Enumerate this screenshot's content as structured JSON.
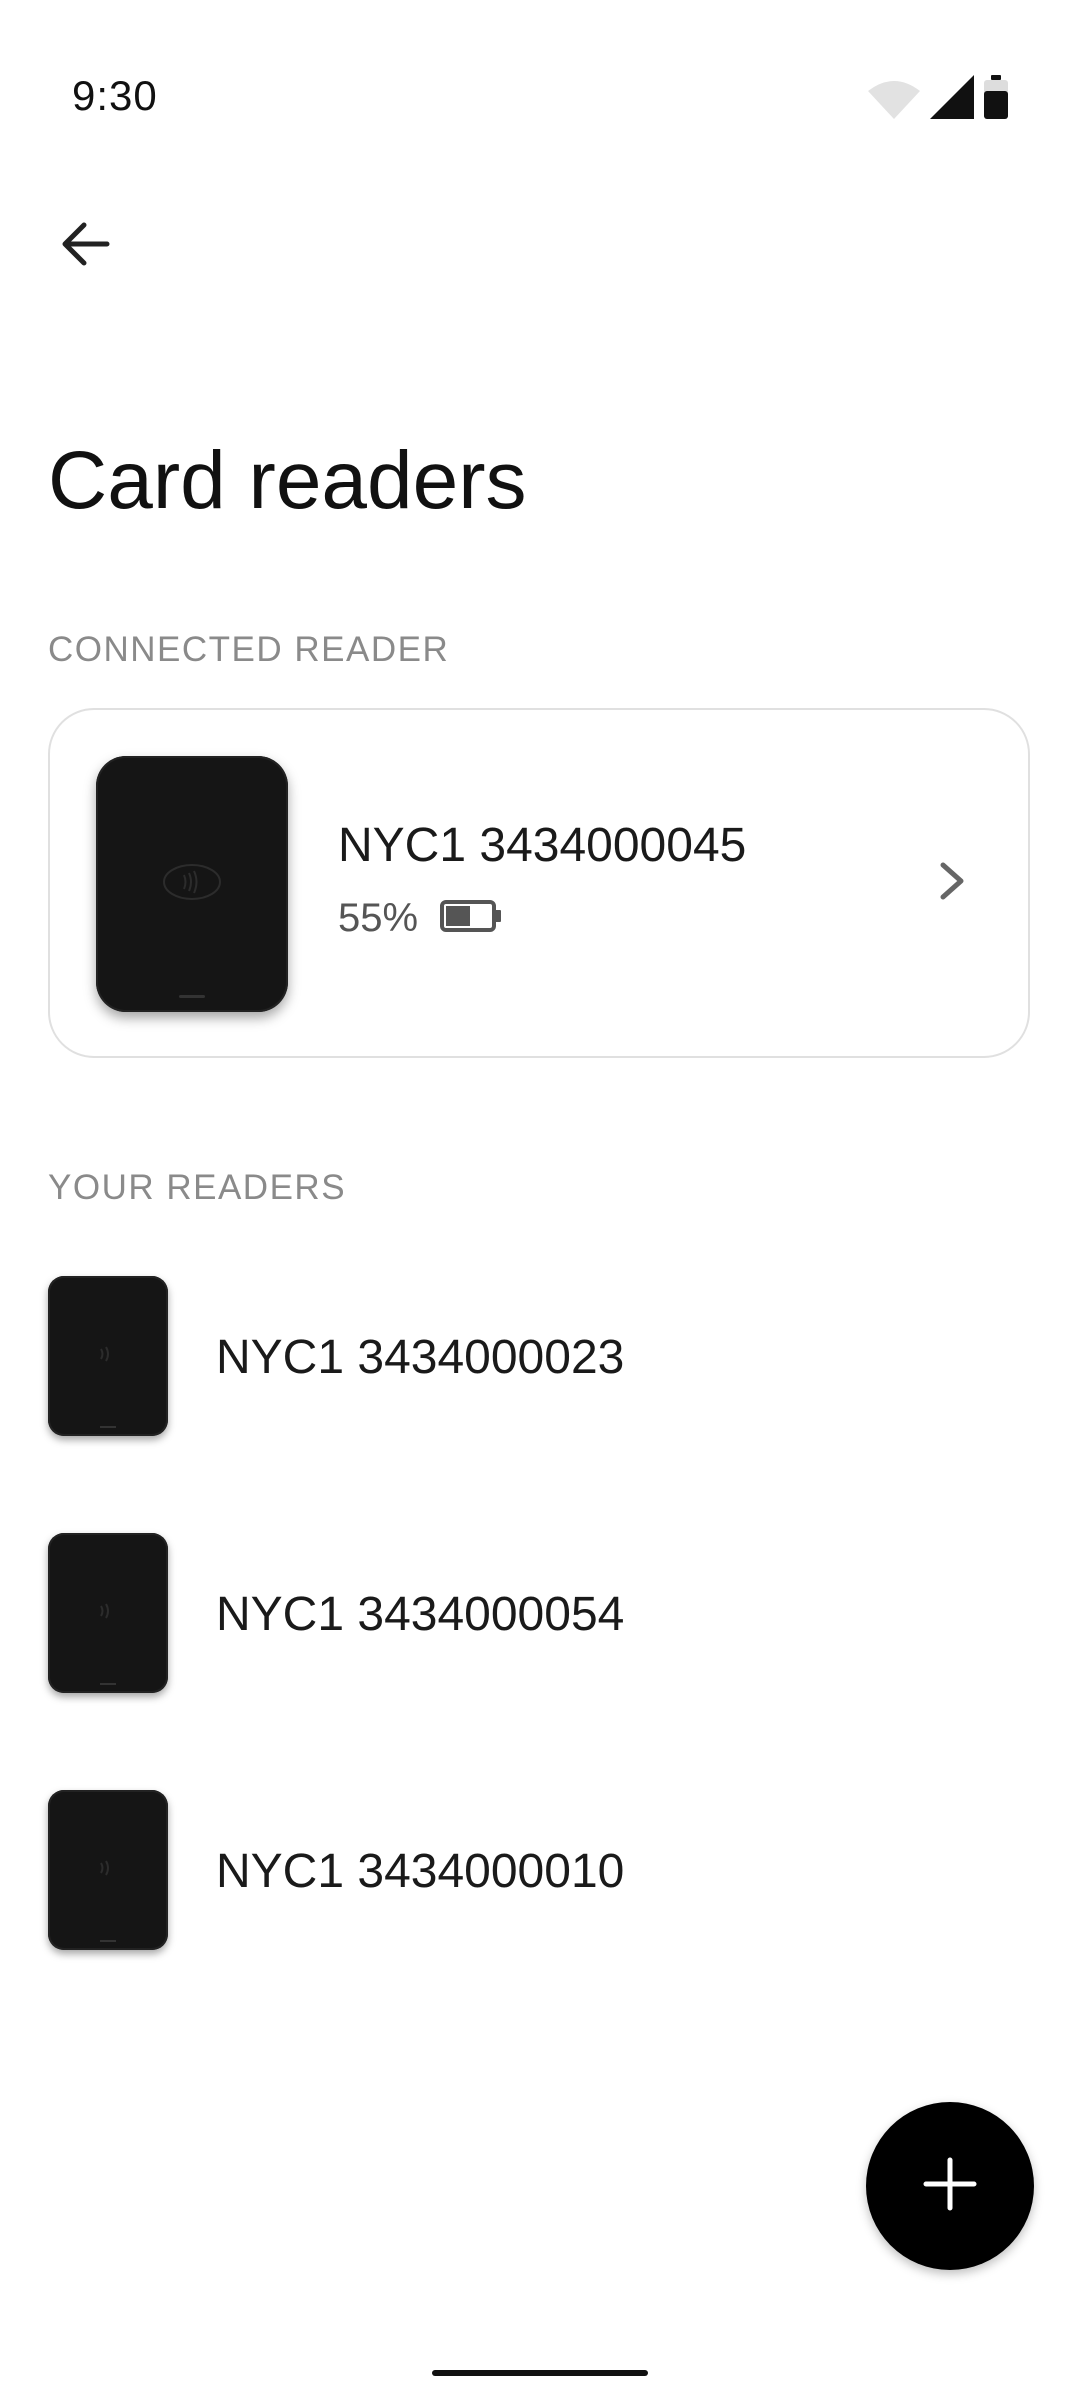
{
  "status_bar": {
    "time": "9:30",
    "icons": [
      "wifi-icon",
      "cellular-signal-icon",
      "battery-icon"
    ]
  },
  "header": {
    "back_icon": "arrow-left-icon",
    "title": "Card readers"
  },
  "connected": {
    "section_label": "CONNECTED READER",
    "reader": {
      "name": "NYC1 3434000045",
      "battery_text": "55%",
      "battery_level": 0.55,
      "chevron_icon": "chevron-right-icon"
    }
  },
  "your_readers": {
    "section_label": "YOUR READERS",
    "items": [
      {
        "name": "NYC1 3434000023"
      },
      {
        "name": "NYC1 3434000054"
      },
      {
        "name": "NYC1 3434000010"
      }
    ]
  },
  "fab": {
    "icon": "plus-icon"
  },
  "colors": {
    "background": "#ffffff",
    "text_primary": "#1a1a1a",
    "text_secondary": "#8a8a8a",
    "device": "#151515",
    "fab": "#000000",
    "card_border": "#e0e0e0"
  }
}
